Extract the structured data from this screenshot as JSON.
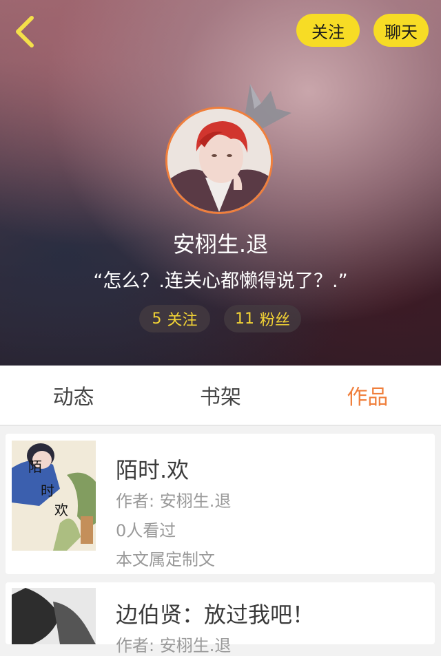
{
  "header": {
    "follow_button": "关注",
    "chat_button": "聊天"
  },
  "profile": {
    "username": "安栩生.退",
    "signature": "“怎么？.连关心都懒得说了？.”",
    "following_count": "5",
    "following_label": "关注",
    "fans_count": "11",
    "fans_label": "粉丝"
  },
  "tabs": [
    {
      "label": "动态",
      "active": false
    },
    {
      "label": "书架",
      "active": false
    },
    {
      "label": "作品",
      "active": true
    }
  ],
  "works": [
    {
      "title": "陌时.欢",
      "author": "作者: 安栩生.退",
      "views": "0人看过",
      "tag": "本文属定制文",
      "cover_text": [
        "陌",
        "时",
        "欢"
      ]
    },
    {
      "title": "边伯贤：放过我吧！",
      "author": "作者: 安栩生.退"
    }
  ],
  "colors": {
    "accent": "#f07f3c",
    "button_yellow": "#f7dc25",
    "stat_text": "#f2d335"
  }
}
